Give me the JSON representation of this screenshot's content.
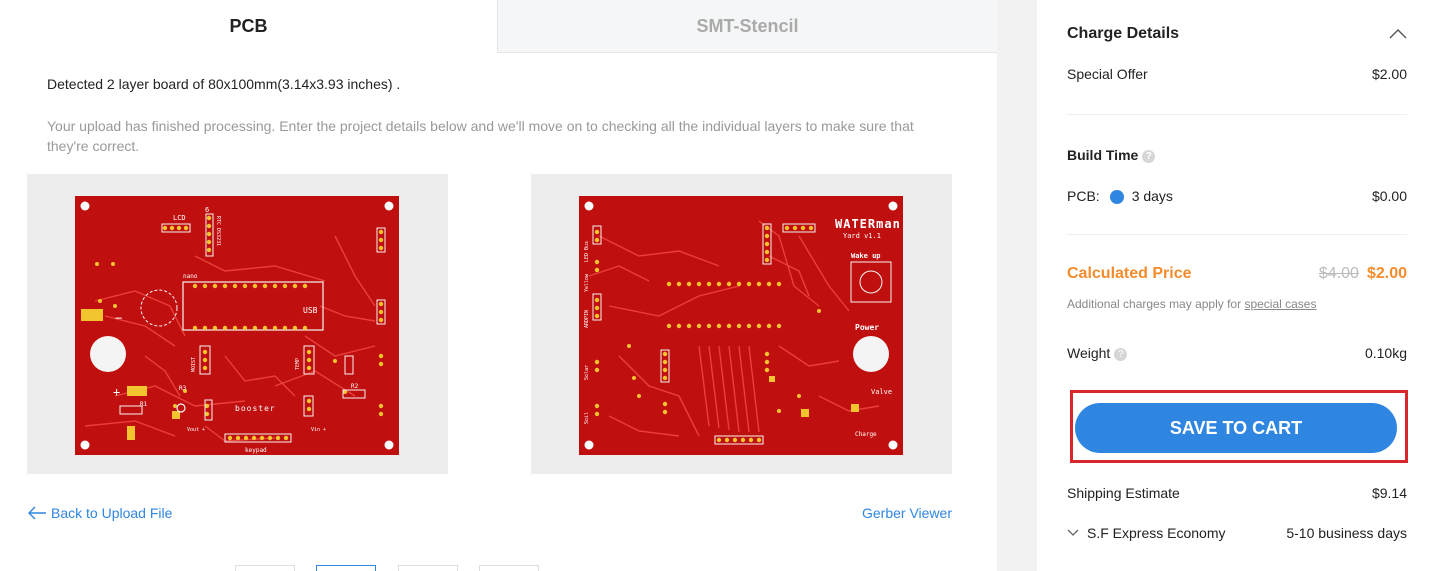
{
  "tabs": {
    "pcb": "PCB",
    "stencil": "SMT-Stencil"
  },
  "board_info": {
    "detected": "Detected 2 layer board of 80x100mm(3.14x3.93 inches) .",
    "notice": "Your upload has finished processing. Enter the project details below and we'll move on to checking all the individual layers to make sure that they're correct."
  },
  "pcb_labels": {
    "top": {
      "lcd": "LCD",
      "usb": "USB",
      "nano": "nano",
      "booster": "booster",
      "keypad": "keypad",
      "vout": "Vout +",
      "vin": "Vin +",
      "r1": "R1",
      "r2": "R2",
      "r3": "R3",
      "minus": "−",
      "plus": "+",
      "moist": "MOIST",
      "temp": "TEMP",
      "rtc": "RTC DS3231",
      "six": "6"
    },
    "bottom": {
      "title": "WATERman",
      "version": "Yard v1.1",
      "wake": "Wake up",
      "power": "Power",
      "valve": "Valve",
      "charge": "Charge",
      "led": "LED Bus",
      "yellow": "Yellow",
      "ardpin": "ARDPIN",
      "solar": "Solar",
      "soil": "Soil"
    }
  },
  "links": {
    "back": "Back to Upload File",
    "gerber": "Gerber Viewer"
  },
  "sidebar": {
    "charge_title": "Charge Details",
    "special_offer_label": "Special Offer",
    "special_offer_value": "$2.00",
    "build_time_label": "Build Time",
    "pcb_label": "PCB:",
    "pcb_days": "3 days",
    "pcb_value": "$0.00",
    "calc_label": "Calculated Price",
    "old_price": "$4.00",
    "new_price": "$2.00",
    "note_prefix": "Additional charges may apply for ",
    "note_link": "special cases",
    "weight_label": "Weight",
    "weight_value": "0.10kg",
    "cart_button": "SAVE TO CART",
    "shipping_label": "Shipping Estimate",
    "shipping_value": "$9.14",
    "shipping_method": "S.F Express Economy",
    "shipping_time": "5-10 business days",
    "help_glyph": "?"
  },
  "colors": {
    "accent": "#2f86e0",
    "price": "#f58b2a",
    "pcb_red": "#c00f0f",
    "highlight": "#d9262c"
  }
}
